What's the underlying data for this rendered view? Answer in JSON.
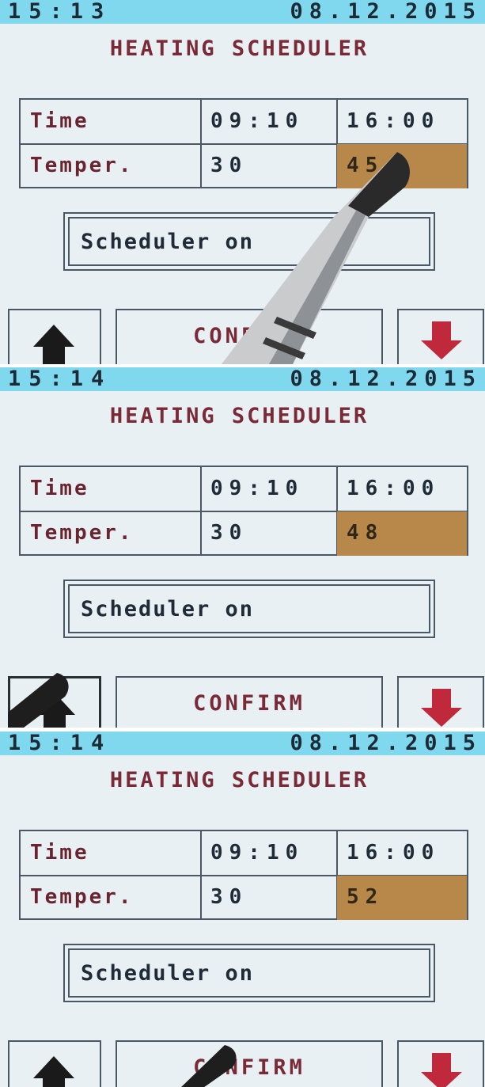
{
  "frames": [
    {
      "status_time": "15:13",
      "status_date": "08.12.2015",
      "title": "HEATING SCHEDULER",
      "table": {
        "row_time_label": "Time",
        "row_temp_label": "Temper.",
        "time_1": "09:10",
        "time_2": "16:00",
        "temp_1": "30",
        "temp_2": "45"
      },
      "scheduler_status": "Scheduler on",
      "confirm_label": "CONFIRM",
      "up_icon": "arrow-up-icon",
      "down_icon": "arrow-down-icon"
    },
    {
      "status_time": "15:14",
      "status_date": "08.12.2015",
      "title": "HEATING SCHEDULER",
      "table": {
        "row_time_label": "Time",
        "row_temp_label": "Temper.",
        "time_1": "09:10",
        "time_2": "16:00",
        "temp_1": "30",
        "temp_2": "48"
      },
      "scheduler_status": "Scheduler on",
      "confirm_label": "CONFIRM",
      "up_icon": "arrow-up-icon",
      "down_icon": "arrow-down-icon"
    },
    {
      "status_time": "15:14",
      "status_date": "08.12.2015",
      "title": "HEATING SCHEDULER",
      "table": {
        "row_time_label": "Time",
        "row_temp_label": "Temper.",
        "time_1": "09:10",
        "time_2": "16:00",
        "temp_1": "30",
        "temp_2": "52"
      },
      "scheduler_status": "Scheduler on",
      "confirm_label": "CONFIRM",
      "up_icon": "arrow-up-icon",
      "down_icon": "arrow-down-icon"
    }
  ],
  "colors": {
    "status_bar": "#7fd8ee",
    "screen_background": "#e9f0f4",
    "title_text": "#7a2a36",
    "selected_cell": "#b8874a",
    "up_arrow": "#1a1a1a",
    "down_arrow": "#c0283c"
  }
}
